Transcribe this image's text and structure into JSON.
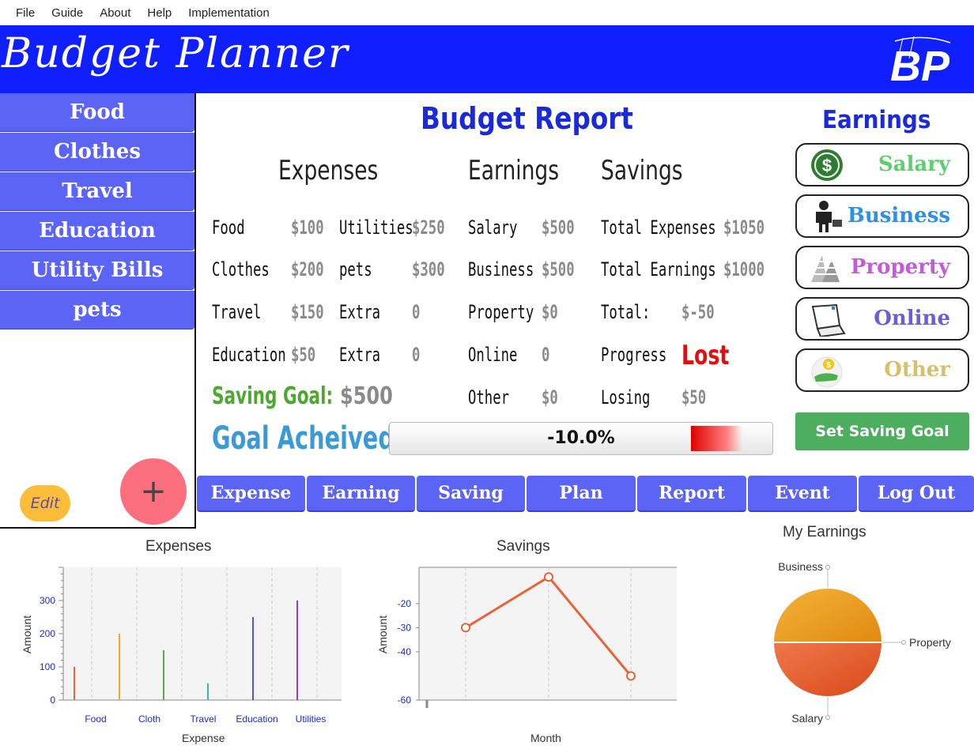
{
  "menu": [
    "File",
    "Guide",
    "About",
    "Help",
    "Implementation"
  ],
  "header": {
    "title": "Budget Planner",
    "logo_text": "BP"
  },
  "sidebar": {
    "items": [
      "Food",
      "Clothes",
      "Travel",
      "Education",
      "Utility Bills",
      "pets"
    ],
    "edit_label": "Edit",
    "add_label": "+"
  },
  "report": {
    "title": "Budget Report",
    "headings": {
      "expenses": "Expenses",
      "earnings": "Earnings",
      "savings": "Savings"
    },
    "expenses_col1": [
      {
        "label": "Food",
        "value": "$100"
      },
      {
        "label": "Clothes",
        "value": "$200"
      },
      {
        "label": "Travel",
        "value": "$150"
      },
      {
        "label": "Education",
        "value": "$50"
      }
    ],
    "expenses_col2": [
      {
        "label": "Utilities",
        "value": "$250"
      },
      {
        "label": "pets",
        "value": "$300"
      },
      {
        "label": "Extra",
        "value": "0"
      },
      {
        "label": "Extra",
        "value": "0"
      }
    ],
    "earnings_col": [
      {
        "label": "Salary",
        "value": "$500"
      },
      {
        "label": "Business",
        "value": "$500"
      },
      {
        "label": "Property",
        "value": "$0"
      },
      {
        "label": "Online",
        "value": "0"
      },
      {
        "label": "Other",
        "value": "$0"
      }
    ],
    "savings_col": [
      {
        "label": "Total Expenses",
        "value": "$1050"
      },
      {
        "label": "Total Earnings",
        "value": "$1000"
      },
      {
        "label": "Total:",
        "value": "$-50"
      },
      {
        "label": "Progress",
        "value": "Lost"
      },
      {
        "label": "Losing",
        "value": "$50"
      }
    ],
    "saving_goal_label": "Saving Goal:",
    "saving_goal_value": "$500",
    "goal_achieved_label": "Goal Acheived:",
    "goal_progress_text": "-10.0%",
    "goal_progress_fraction": -0.1
  },
  "earnings_panel": {
    "title": "Earnings",
    "buttons": [
      {
        "label": "Salary",
        "color": "#5ccf6e",
        "icon": "dollar-coin-icon"
      },
      {
        "label": "Business",
        "color": "#2f8fe0",
        "icon": "businessman-icon"
      },
      {
        "label": "Property",
        "color": "#c25bd8",
        "icon": "buildings-icon"
      },
      {
        "label": "Online",
        "color": "#6a5fd8",
        "icon": "laptop-icon"
      },
      {
        "label": "Other",
        "color": "#d8c06a",
        "icon": "money-hand-icon"
      }
    ],
    "set_goal_label": "Set Saving Goal"
  },
  "nav": [
    "Expense",
    "Earning",
    "Saving",
    "Plan",
    "Report",
    "Event",
    "Log Out"
  ],
  "colors": {
    "header_blue": "#0f1fff",
    "button_blue": "#5b64f4",
    "title_blue": "#1a2ad8"
  },
  "chart_data": [
    {
      "type": "bar",
      "title": "Expenses",
      "xlabel": "Expense",
      "ylabel": "Amount",
      "categories": [
        "Food",
        "Cloth",
        "Travel",
        "Education",
        "Utilities"
      ],
      "x_tick_labels": [
        "Food",
        "Cloth",
        "Travel",
        "Education",
        "Utilities"
      ],
      "bars": [
        {
          "category": "Food",
          "value": 100,
          "color": "#e8633a"
        },
        {
          "category": "Food",
          "value": 200,
          "color": "#f0a830"
        },
        {
          "category": "Cloth",
          "value": 150,
          "color": "#4caf50"
        },
        {
          "category": "Travel",
          "value": 50,
          "color": "#3ab0c8"
        },
        {
          "category": "Education",
          "value": 250,
          "color": "#4a5ac8"
        },
        {
          "category": "Utilities",
          "value": 300,
          "color": "#9a3ad0"
        }
      ],
      "y_ticks": [
        0,
        100,
        200,
        300
      ],
      "ylim": [
        0,
        400
      ],
      "grid": true
    },
    {
      "type": "line",
      "title": "Savings",
      "xlabel": "Month",
      "ylabel": "Amount",
      "points": [
        {
          "x": 1,
          "y": -30
        },
        {
          "x": 2,
          "y": -9
        },
        {
          "x": 3,
          "y": -50
        }
      ],
      "y_ticks": [
        -20,
        -30,
        -40,
        -60
      ],
      "ylim": [
        -60,
        -5
      ],
      "color": "#e8633a",
      "grid": true
    },
    {
      "type": "pie",
      "title": "My Earnings",
      "slices": [
        {
          "label": "Business",
          "value": 500,
          "color": "#f0a020"
        },
        {
          "label": "Property",
          "value": 0,
          "color": "#cccccc"
        },
        {
          "label": "Salary",
          "value": 500,
          "color": "#e8582a"
        }
      ]
    }
  ]
}
